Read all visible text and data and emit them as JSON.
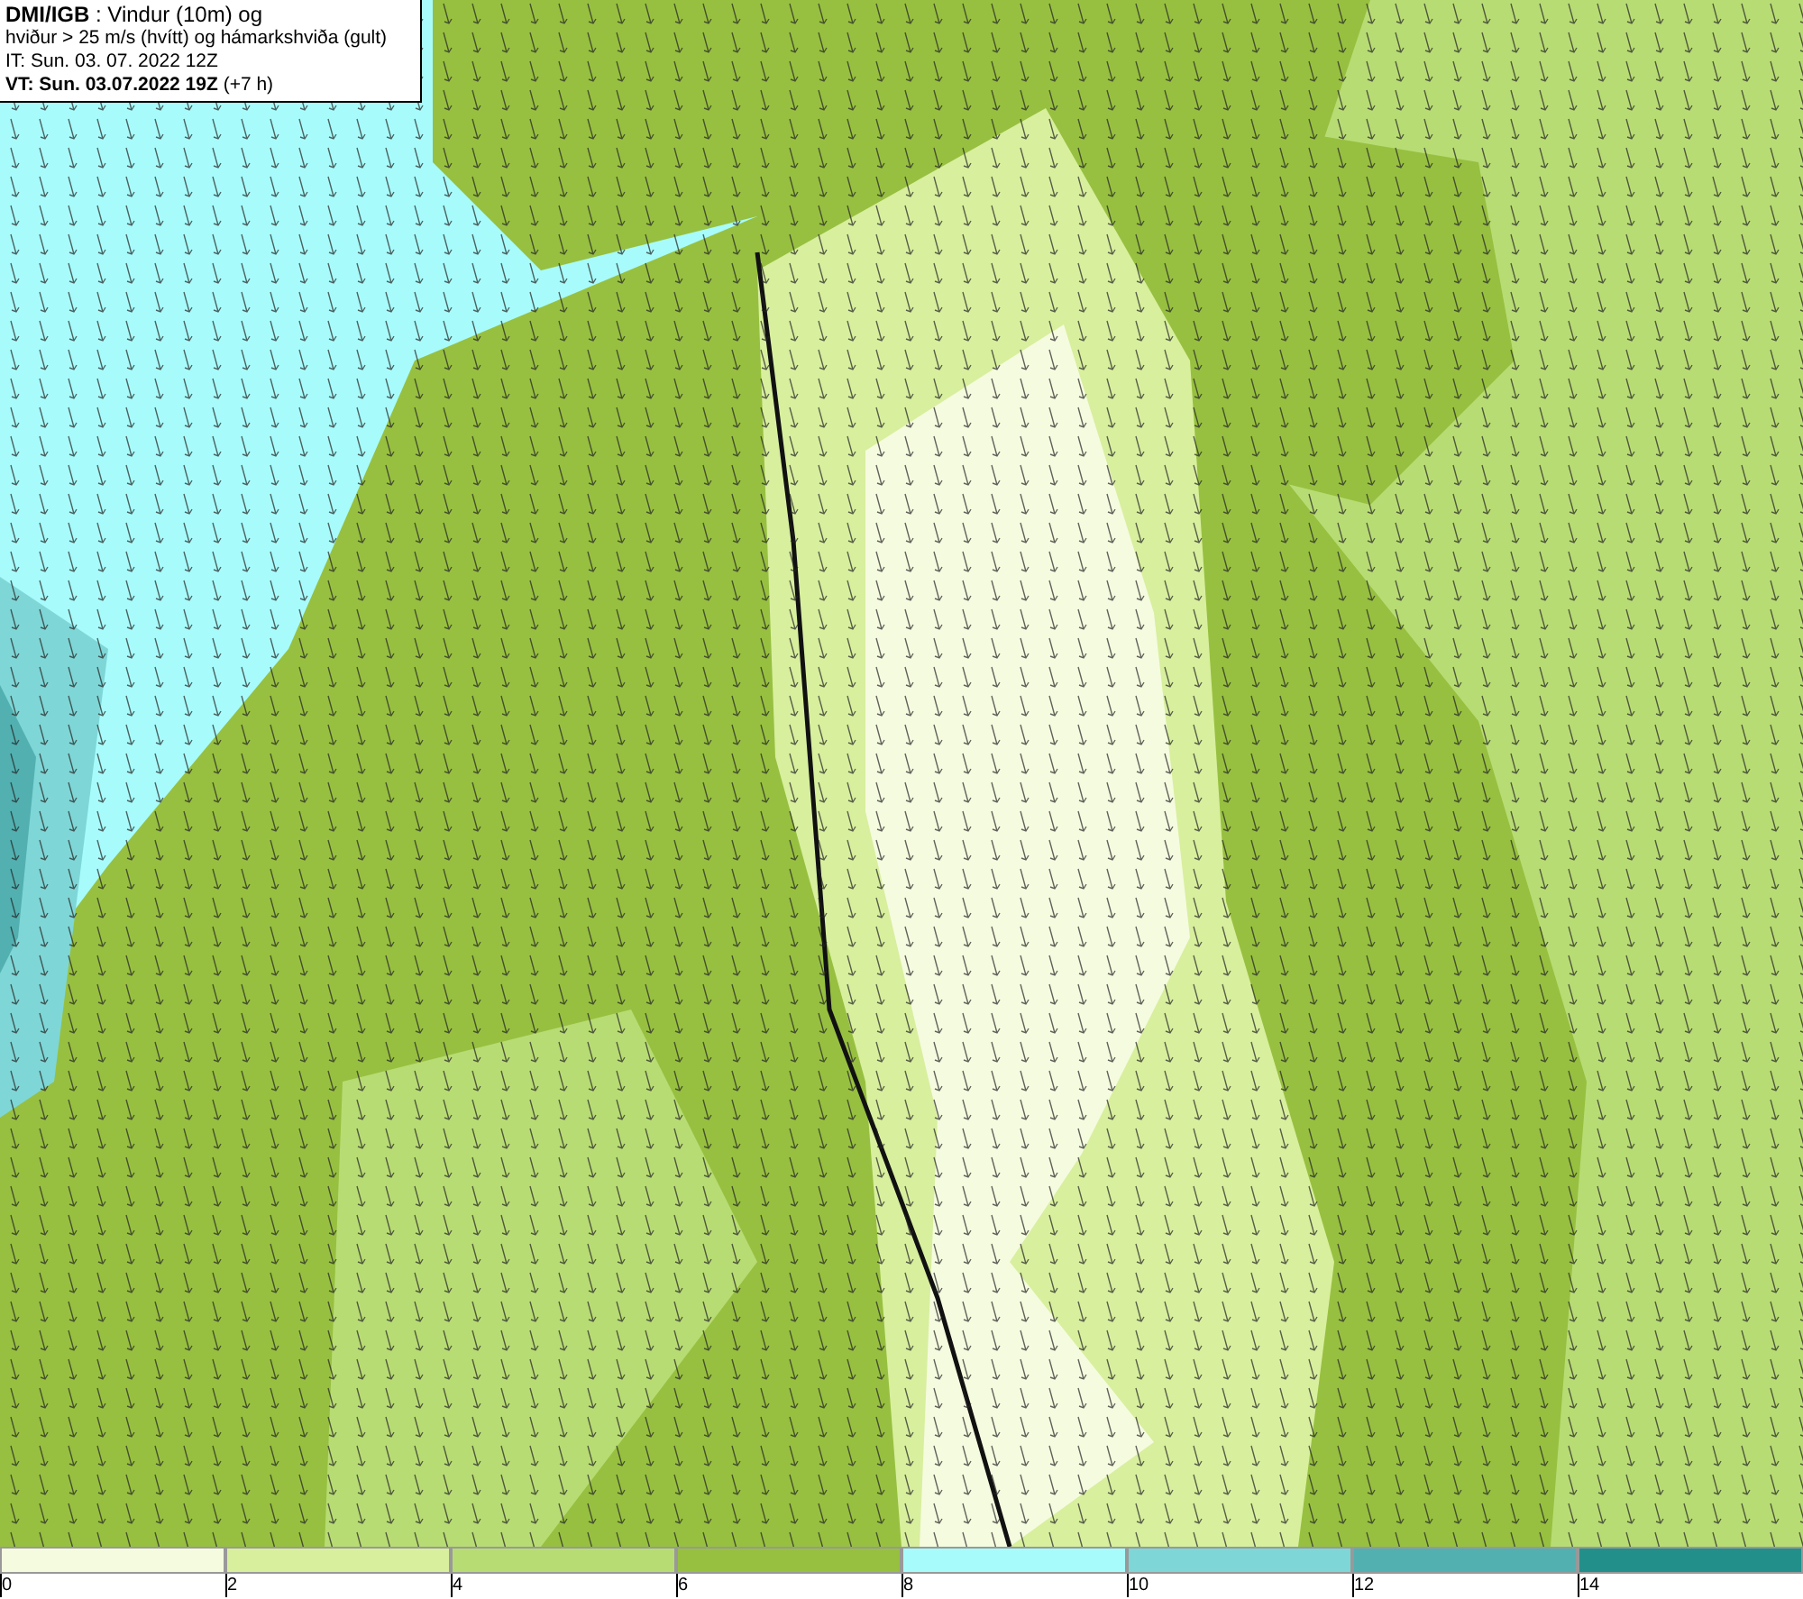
{
  "header": {
    "lines": [
      "**DMI/IGB** : Vindur (10m) og",
      "hviður > 25 m/s (hvítt) og hámarkshviða (gult)",
      "IT: Sun. 03. 07. 2022 12Z",
      "**VT: Sun. 03.07.2022 19Z** (+7 h)"
    ]
  },
  "legend": {
    "bins": [
      {
        "color": "#f5fbdf",
        "label": "0"
      },
      {
        "color": "#d8ef9e",
        "label": "2"
      },
      {
        "color": "#b8dc74",
        "label": "4"
      },
      {
        "color": "#97c040",
        "label": "6"
      },
      {
        "color": "#a8fbfb",
        "label": "8"
      },
      {
        "color": "#7fd6d6",
        "label": "10"
      },
      {
        "color": "#52b0b0",
        "label": "12"
      },
      {
        "color": "#238f8a",
        "label": "14"
      }
    ]
  }
}
